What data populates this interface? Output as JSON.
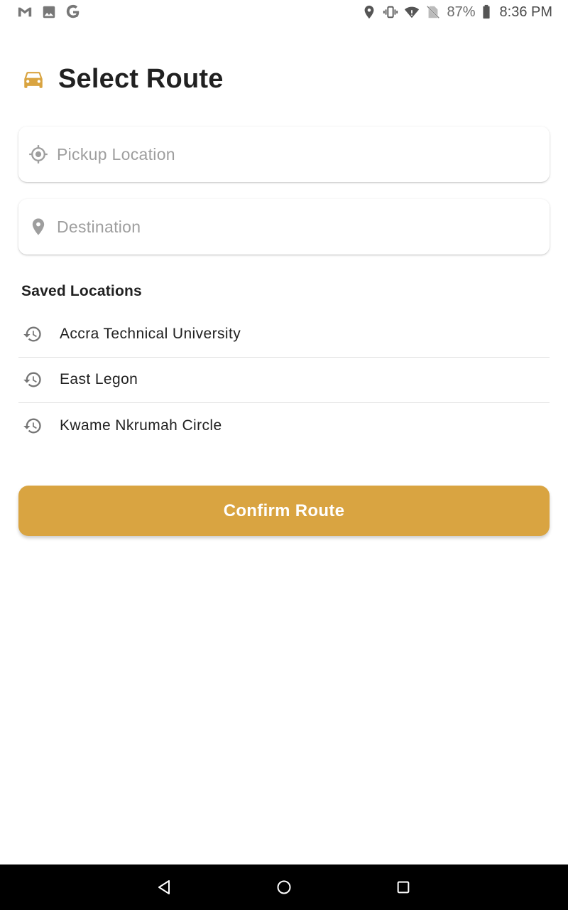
{
  "status_bar": {
    "left_icons": [
      "gmail-icon",
      "image-icon",
      "google-icon"
    ],
    "right_icons": [
      "location-icon",
      "vibrate-icon",
      "wifi-icon",
      "no-sim-icon",
      "battery-icon"
    ],
    "battery_percent": "87%",
    "time": "8:36 PM"
  },
  "header": {
    "icon": "car-icon",
    "title": "Select Route"
  },
  "pickup": {
    "icon": "gps-crosshair-icon",
    "placeholder": "Pickup Location",
    "value": ""
  },
  "destination": {
    "icon": "location-pin-icon",
    "placeholder": "Destination",
    "value": ""
  },
  "saved": {
    "title": "Saved Locations",
    "items": [
      {
        "label": "Accra Technical University",
        "icon": "history-icon"
      },
      {
        "label": "East Legon",
        "icon": "history-icon"
      },
      {
        "label": "Kwame Nkrumah Circle",
        "icon": "history-icon"
      }
    ]
  },
  "confirm_button": {
    "label": "Confirm Route"
  },
  "nav_bar": {
    "buttons": [
      "back-icon",
      "home-icon",
      "recents-icon"
    ]
  },
  "colors": {
    "accent": "#d9a441",
    "text": "#212121",
    "placeholder": "#9e9e9e",
    "icon_gray": "#9e9e9e",
    "nav_background": "#000000"
  }
}
